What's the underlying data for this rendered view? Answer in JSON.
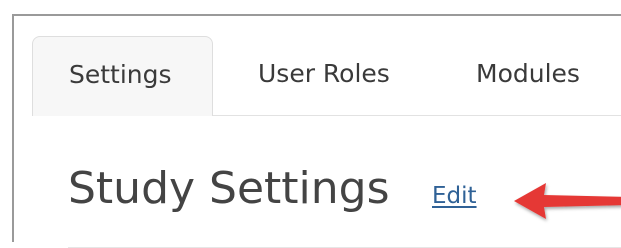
{
  "tabs": [
    {
      "label": "Settings",
      "active": true
    },
    {
      "label": "User Roles",
      "active": false
    },
    {
      "label": "Modules",
      "active": false
    }
  ],
  "page": {
    "title": "Study Settings",
    "edit_label": "Edit"
  },
  "colors": {
    "link": "#2f6196",
    "arrow": "#e53935",
    "active_tab_bg": "#f7f7f7",
    "text": "#3a3a3a"
  },
  "icons": {
    "annotation": "arrow-left-icon"
  }
}
